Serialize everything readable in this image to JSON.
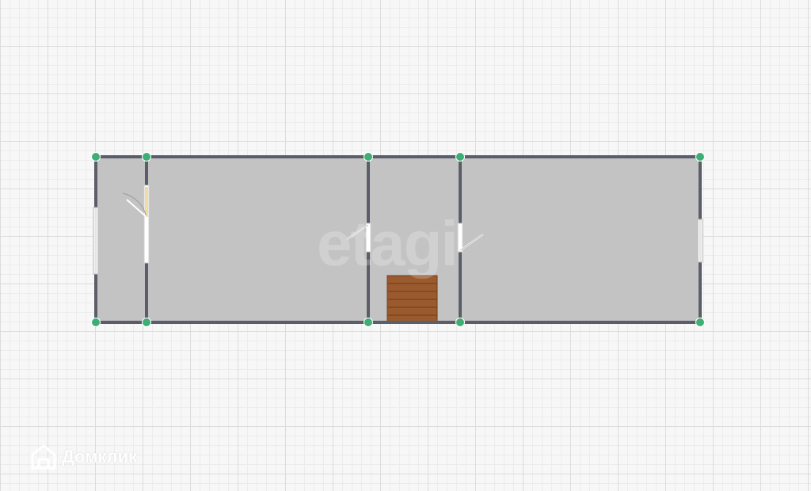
{
  "plan": {
    "watermark_text": "etagi",
    "brand_text": "Домклик"
  },
  "colors": {
    "room_fill": "#c3c3c3",
    "wall": "#5b5e6a",
    "node": "#3fae75",
    "stairs": "#9b5a2e",
    "window": "#f4f4f4",
    "door": "#ffffff",
    "door_highlight": "#f2dc9c"
  },
  "icons": [
    "house-icon"
  ]
}
